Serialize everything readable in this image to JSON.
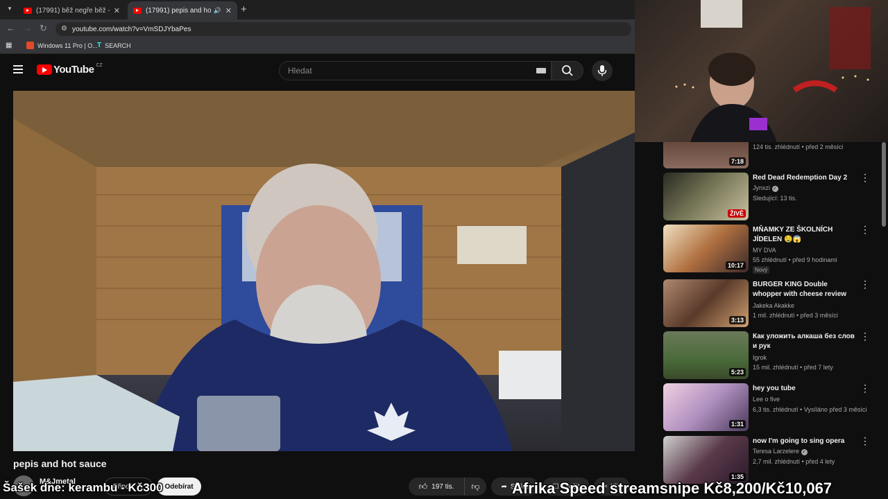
{
  "browser": {
    "tabs": [
      {
        "label": "(17991) běž negře běž - YouTube",
        "active": false
      },
      {
        "label": "(17991) pepis and hot sauce",
        "active": true
      }
    ],
    "new_tab": "+",
    "url": "youtube.com/watch?v=VmSDJYbaPes",
    "bookmarks": [
      {
        "label": "Windows 11 Pro | O..."
      },
      {
        "label": "SEARCH"
      }
    ]
  },
  "youtube": {
    "logo": "YouTube",
    "region": "CZ",
    "search_placeholder": "Hledat",
    "video_title": "pepis and hot sauce",
    "channel": "M&Jmetal",
    "join_label": "Připojit se",
    "subscribe_label": "Odebírat",
    "likes": "197 tis.",
    "share_label": "Sdílet",
    "save_label": "Uložit",
    "clip_label": "Klip"
  },
  "recommendations": [
    {
      "title": "",
      "channel": "",
      "meta": "124 tis. zhlédnutí • před 2 měsíci",
      "duration": "7:18",
      "badge": ""
    },
    {
      "title": "Red Dead Redemption Day 2",
      "channel": "Jynxzi",
      "meta": "Sledující: 13 tis.",
      "duration": "",
      "badge": "ŽIVĚ"
    },
    {
      "title": "MŇAMKY ZE ŠKOLNÍCH JÍDELEN 🤤😱",
      "channel": "MY DVA",
      "meta": "55 zhlédnutí • před 9 hodinami",
      "duration": "10:17",
      "badge": "Nový"
    },
    {
      "title": "BURGER KING Double whopper with cheese review",
      "channel": "Jakeka Akakke",
      "meta": "1 mil. zhlédnutí • před 3 měsíci",
      "duration": "3:13",
      "badge": ""
    },
    {
      "title": "Как уложить алкаша без слов и рук",
      "channel": "Igrok",
      "meta": "15 mil. zhlédnutí • před 7 lety",
      "duration": "5:23",
      "badge": ""
    },
    {
      "title": "hey you tube",
      "channel": "Lee o five",
      "meta": "6,3 tis. zhlédnutí • Vysíláno před 3 měsíci",
      "duration": "1:31",
      "badge": ""
    },
    {
      "title": "now I'm going to sing opera",
      "channel": "Teresa Larzelere",
      "meta": "2,7 mil. zhlédnutí • před 4 lety",
      "duration": "1:35",
      "badge": ""
    }
  ],
  "overlays": {
    "left": "Šašek dne: kerambu - Kč300",
    "right": "Afrika Speed streamsnipe Kč8,200/Kč10,067"
  },
  "colors": {
    "accent": "#ff0000",
    "bg": "#0f0f0f"
  }
}
